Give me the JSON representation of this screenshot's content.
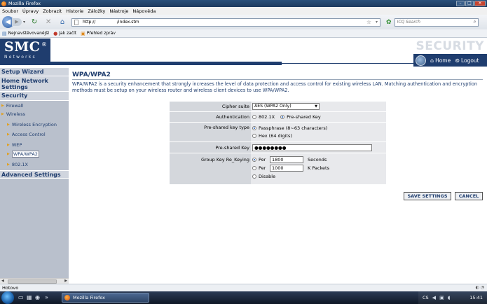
{
  "window": {
    "title": "Mozilla Firefox",
    "controls": [
      "–",
      "□",
      "✕"
    ]
  },
  "menu": [
    "Soubor",
    "Úpravy",
    "Zobrazit",
    "Historie",
    "Záložky",
    "Nástroje",
    "Nápověda"
  ],
  "navbar": {
    "url": "http://                /index.stm",
    "search_placeholder": "ICQ Search"
  },
  "bookmarks": [
    {
      "label": "Nejnavštěvovanější",
      "icon": "page-icon",
      "color": "#3b6fb0"
    },
    {
      "label": "Jak začít",
      "icon": "firefox-icon",
      "color": "#c0392b"
    },
    {
      "label": "Přehled zpráv",
      "icon": "rss-icon",
      "color": "#e08a1e"
    }
  ],
  "header": {
    "logo_big": "SMC",
    "logo_reg": "®",
    "logo_small": "Networks",
    "watermark": "SECURITY",
    "home": "Home",
    "logout": "Logout"
  },
  "sidebar": {
    "setup_wizard": "Setup Wizard",
    "home_network_settings": "Home Network Settings",
    "security": "Security",
    "firewall": "Firewall",
    "wireless": "Wireless",
    "wireless_encryption": "Wireless Encryption",
    "access_control": "Access Control",
    "wep": "WEP",
    "wpa_wpa2": "WPA/WPA2",
    "x8021": "802.1X",
    "advanced_settings": "Advanced Settings"
  },
  "main": {
    "title": "WPA/WPA2",
    "description": "WPA/WPA2 is a security enhancement that strongly increases the level of data protection and access control for existing wireless LAN. Matching authentication and encryption methods must be setup on your wireless router and wireless client devices to use WPA/WPA2.",
    "form": {
      "cipher_label": "Cipher suite",
      "cipher_value": "AES (WPA2 Only)",
      "auth_label": "Authentication",
      "auth_options": [
        "802.1X",
        "Pre-shared Key"
      ],
      "auth_selected": "Pre-shared Key",
      "psk_type_label": "Pre-shared key type",
      "psk_type_options": [
        "Passphrase (8~63 characters)",
        "Hex (64 digits)"
      ],
      "psk_type_selected": "Passphrase (8~63 characters)",
      "psk_label": "Pre-shared Key",
      "psk_value": "●●●●●●●●",
      "rekey_label": "Group Key Re_Keying",
      "rekey_per_seconds_label": "Per",
      "rekey_seconds_value": "1800",
      "rekey_seconds_unit": "Seconds",
      "rekey_per_packets_label": "Per",
      "rekey_packets_value": "1000",
      "rekey_packets_unit": "K Packets",
      "rekey_disable": "Disable",
      "rekey_selected": "Per Seconds"
    },
    "save_button": "SAVE SETTINGS",
    "cancel_button": "CANCEL"
  },
  "statusbar": {
    "text": "Hotovo"
  },
  "taskbar": {
    "task_label": "Mozilla Firefox",
    "lang": "CS",
    "clock": "15:41"
  }
}
